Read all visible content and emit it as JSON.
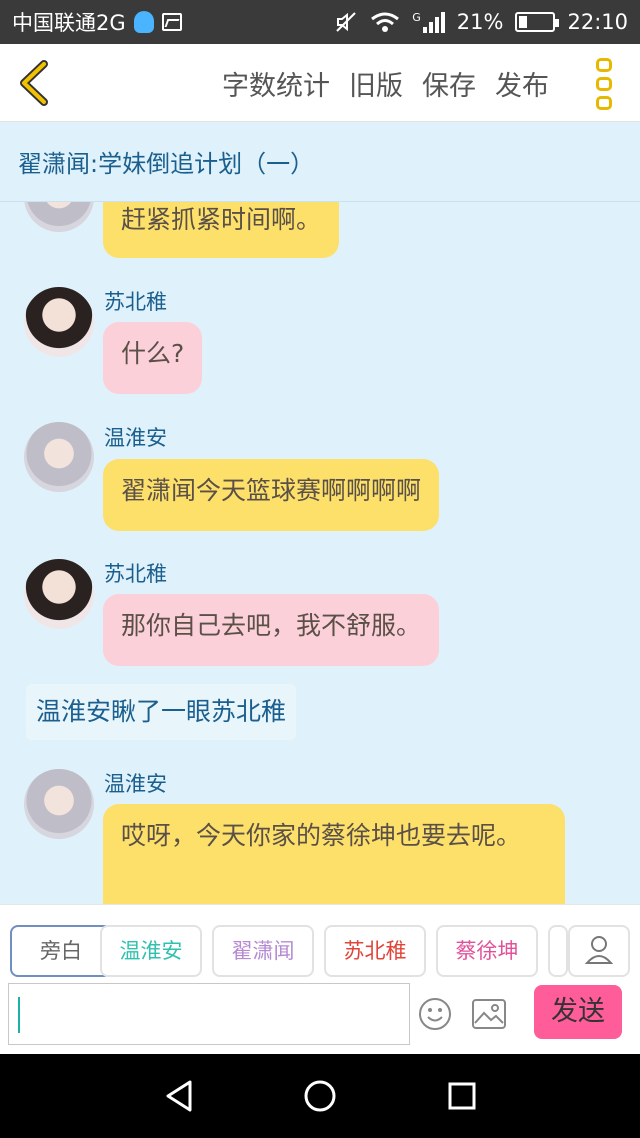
{
  "status_bar": {
    "carrier": "中国联通2G",
    "network_type": "G",
    "battery": "21%",
    "time": "22:10"
  },
  "nav": {
    "actions": [
      "字数统计",
      "旧版",
      "保存",
      "发布"
    ]
  },
  "story": {
    "title": "翟潇闻:学妹倒追计划（一）"
  },
  "messages": {
    "m0": {
      "text": "赶紧抓紧时间啊。"
    },
    "m1": {
      "speaker": "苏北稚",
      "text": "什么?"
    },
    "m2": {
      "speaker": "温淮安",
      "text": "翟潇闻今天篮球赛啊啊啊啊"
    },
    "m3": {
      "speaker": "苏北稚",
      "text": "那你自己去吧，我不舒服。"
    },
    "narration": "温淮安瞅了一眼苏北稚",
    "m4": {
      "speaker": "温淮安",
      "text": "哎呀，今天你家的蔡徐坤也要去呢。"
    }
  },
  "role_tabs": [
    {
      "label": "旁白",
      "color": "#666666"
    },
    {
      "label": "温淮安",
      "color": "#2fc1b0"
    },
    {
      "label": "翟潇闻",
      "color": "#b58ad3"
    },
    {
      "label": "苏北稚",
      "color": "#e0453a"
    },
    {
      "label": "蔡徐坤",
      "color": "#e0529a"
    }
  ],
  "composer": {
    "input_value": "",
    "send_label": "发送"
  },
  "colors": {
    "background": "#dff1fa",
    "bubble_yellow": "#fde06a",
    "bubble_pink": "#fcd0d9",
    "send": "#ff5c9a",
    "accent": "#e7b800"
  },
  "icons": [
    "back-chevron-icon",
    "more-vertical-icon",
    "emoji-icon",
    "image-icon",
    "profile-icon",
    "nav-back-icon",
    "nav-home-icon",
    "nav-recent-icon"
  ]
}
